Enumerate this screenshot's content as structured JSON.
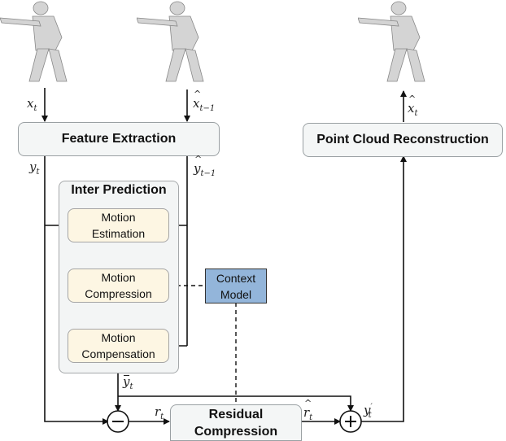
{
  "diagram": {
    "nodes": {
      "feature_extraction": "Feature Extraction",
      "point_cloud_reconstruction": "Point Cloud Reconstruction",
      "inter_prediction": "Inter Prediction",
      "motion_estimation": [
        "Motion",
        "Estimation"
      ],
      "motion_compression": [
        "Motion",
        "Compression"
      ],
      "motion_compensation": [
        "Motion",
        "Compensation"
      ],
      "context_model": [
        "Context",
        "Model"
      ],
      "residual_compression": [
        "Residual",
        "Compression"
      ]
    },
    "operators": {
      "subtract": "−",
      "add": "+"
    },
    "variables": {
      "x_t": {
        "base": "x",
        "sub": "t"
      },
      "x_hat_t_minus_1": {
        "base": "x",
        "sub": "t−1"
      },
      "y_t": {
        "base": "y",
        "sub": "t"
      },
      "y_hat_t_minus_1": {
        "base": "y",
        "sub": "t−1"
      },
      "y_bar_t": {
        "base": "y",
        "sub": "t"
      },
      "r_t": {
        "base": "r",
        "sub": "t"
      },
      "r_hat_t": {
        "base": "r",
        "sub": "t"
      },
      "y_prime_t": {
        "base": "y",
        "sub": "t",
        "sup": "′"
      },
      "x_hat_t": {
        "base": "x",
        "sub": "t"
      }
    },
    "images": {
      "input_frame": "point-cloud-soldier",
      "reference_frame": "point-cloud-soldier",
      "reconstructed_frame": "point-cloud-soldier"
    },
    "colors": {
      "context_model_fill": "#93b5da",
      "motion_box_fill": "#fdf6e3",
      "gray_box_fill": "#f4f6f6"
    }
  }
}
